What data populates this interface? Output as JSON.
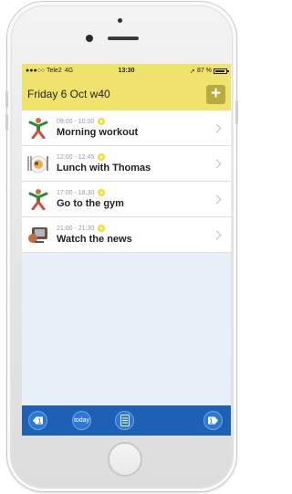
{
  "status_bar": {
    "carrier": "●●●○○ Tele2",
    "network": "4G",
    "time": "13:30",
    "battery": "87 %"
  },
  "header": {
    "title": "Friday 6 Oct w40",
    "add_label": "+"
  },
  "events": [
    {
      "time": "09:00 - 10:00",
      "title": "Morning workout",
      "icon": "exercise-icon"
    },
    {
      "time": "12:00 - 12:45",
      "title": "Lunch with Thomas",
      "icon": "meal-icon"
    },
    {
      "time": "17:00 - 18:30",
      "title": "Go to the gym",
      "icon": "exercise-icon"
    },
    {
      "time": "21:00 - 21:30",
      "title": "Watch the news",
      "icon": "tv-icon"
    }
  ],
  "toolbar": {
    "today_label": "today",
    "icons": [
      "previous-day-icon",
      "today-icon",
      "calendar-icon",
      "next-day-icon"
    ]
  },
  "colors": {
    "header_yellow": "#efe36c",
    "add_button": "#b6ab3f",
    "toolbar_blue": "#1e61b4",
    "clock_yellow": "#f4dd30"
  }
}
